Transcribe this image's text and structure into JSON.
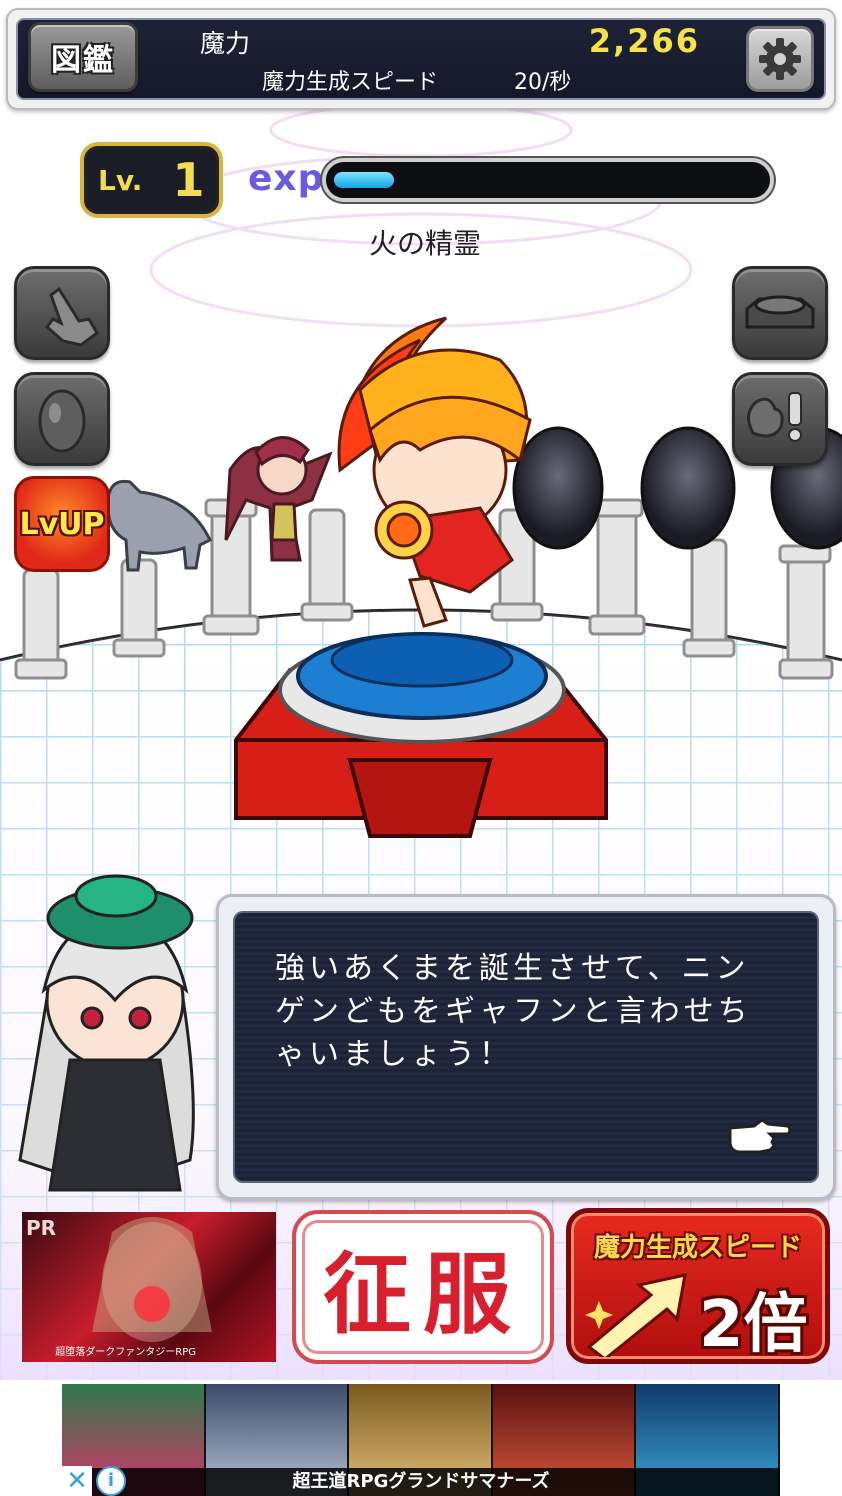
{
  "header": {
    "zukan_label": "図鑑",
    "maryoku_label": "魔力",
    "maryoku_value": "2,266",
    "speed_label": "魔力生成スピード",
    "speed_value": "20/秒",
    "settings_icon": "gear-icon"
  },
  "level": {
    "prefix": "Lv.",
    "value": "1",
    "exp_label": "exp",
    "exp_progress": 0.14,
    "monster_name": "火の精霊"
  },
  "side_buttons": {
    "left": [
      "tap-hand-icon",
      "egg-icon"
    ],
    "lvup_label": "LvUP",
    "right": [
      "altar-icon",
      "alert-icon"
    ]
  },
  "dialog": {
    "lines": [
      "強いあくまを誕生させて、ニン",
      "ゲンどもをギャフンと言わせち",
      "ゃいましょう！"
    ],
    "next_icon": "pointing-hand-icon"
  },
  "bottom": {
    "pr_label": "PR",
    "pr_caption": "超堕落ダークファンタジーRPG",
    "conquer_label": "征服",
    "speed_boost_title": "魔力生成スピード",
    "speed_boost_mult": "2倍"
  },
  "ad": {
    "caption": "超王道RPGグランドサマナーズ",
    "close_label": "✕",
    "info_label": "i"
  },
  "colors": {
    "accent_gold": "#f2dc54",
    "exp_bar": "#12a5e8",
    "conquer_red": "#d7202e",
    "boost_red": "#e82a1f"
  }
}
